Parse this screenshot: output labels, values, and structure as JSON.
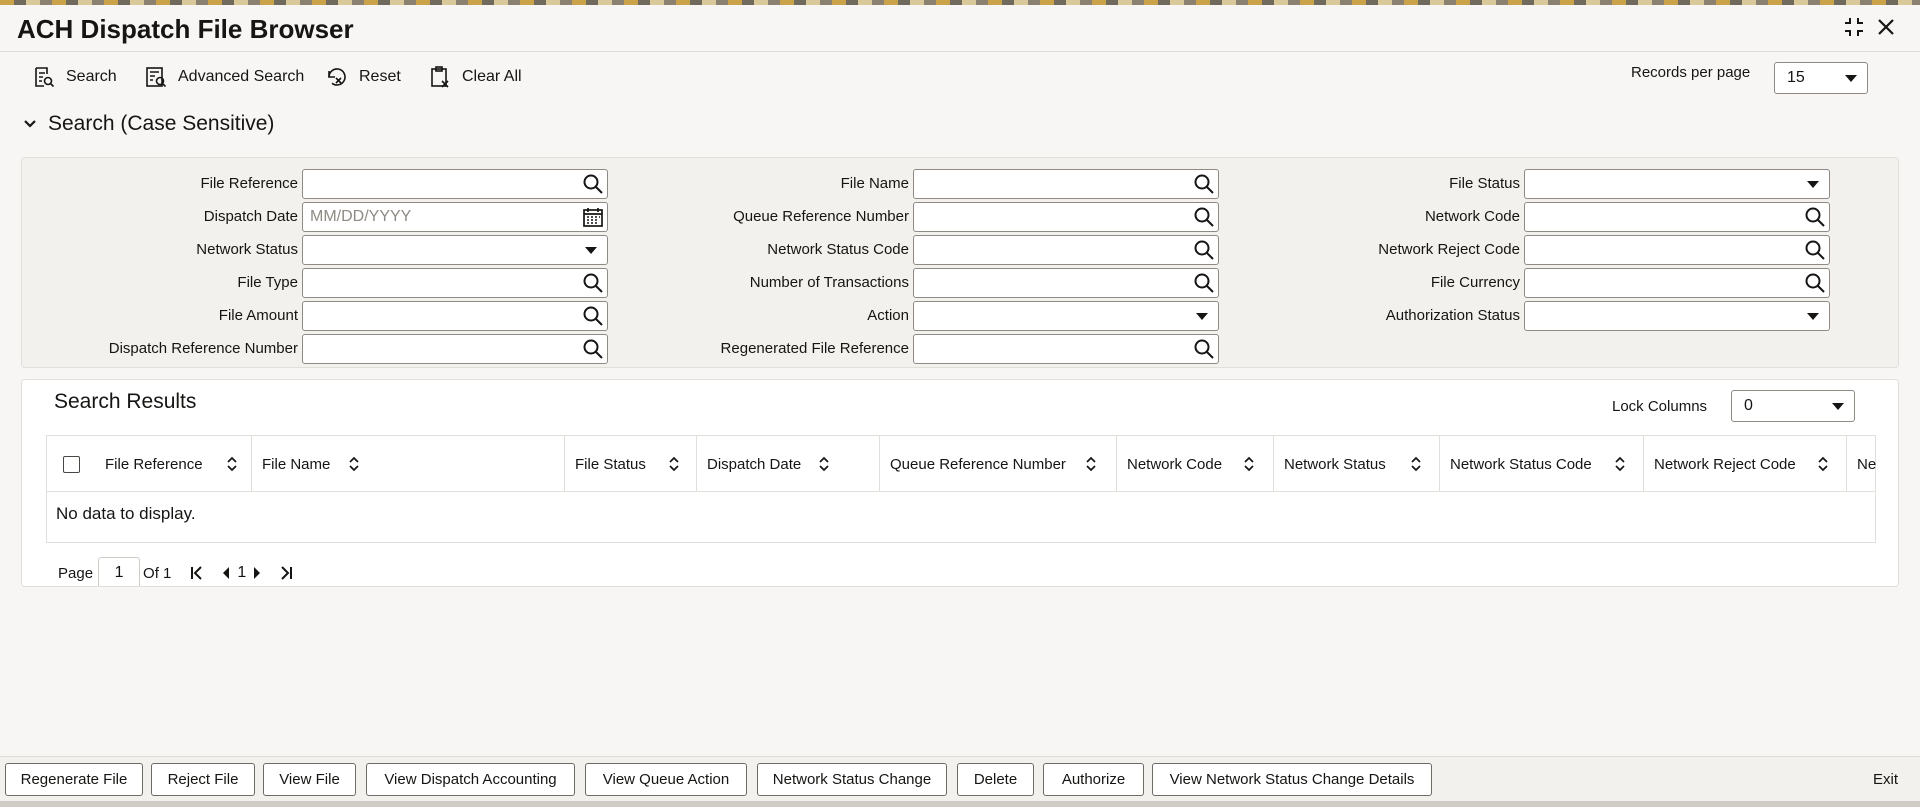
{
  "window": {
    "title": "ACH Dispatch File Browser"
  },
  "toolbar": {
    "search": "Search",
    "advanced_search": "Advanced Search",
    "reset": "Reset",
    "clear_all": "Clear All",
    "records_per_page_label": "Records per page",
    "records_per_page_value": "15"
  },
  "search_section": {
    "title": "Search (Case Sensitive)",
    "fields": {
      "file_reference": "File Reference",
      "dispatch_date": "Dispatch Date",
      "dispatch_date_placeholder": "MM/DD/YYYY",
      "network_status": "Network Status",
      "file_type": "File Type",
      "file_amount": "File Amount",
      "dispatch_reference_number": "Dispatch Reference Number",
      "file_name": "File Name",
      "queue_reference_number": "Queue Reference Number",
      "network_status_code": "Network Status Code",
      "number_of_transactions": "Number of Transactions",
      "action": "Action",
      "regenerated_file_reference": "Regenerated File Reference",
      "file_status": "File Status",
      "network_code": "Network Code",
      "network_reject_code": "Network Reject Code",
      "file_currency": "File Currency",
      "authorization_status": "Authorization Status"
    }
  },
  "results": {
    "title": "Search Results",
    "lock_columns_label": "Lock Columns",
    "lock_columns_value": "0",
    "columns": [
      "File Reference",
      "File Name",
      "File Status",
      "Dispatch Date",
      "Queue Reference Number",
      "Network Code",
      "Network Status",
      "Network Status Code",
      "Network Reject Code",
      "Ne"
    ],
    "empty_message": "No data to display.",
    "pager": {
      "page_label": "Page",
      "page_value": "1",
      "of_label": "Of 1",
      "current": "1"
    }
  },
  "footer": {
    "buttons": [
      "Regenerate File",
      "Reject File",
      "View File",
      "View Dispatch Accounting",
      "View Queue Action",
      "Network Status Change",
      "Delete",
      "Authorize",
      "View Network Status Change Details"
    ],
    "exit": "Exit"
  }
}
